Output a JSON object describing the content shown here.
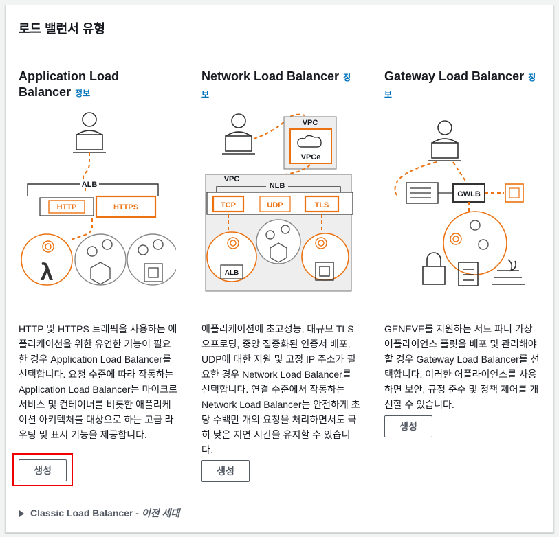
{
  "header": {
    "title": "로드 밸런서 유형"
  },
  "info_label": "정보",
  "cards": [
    {
      "title": "Application Load Balancer",
      "description": "HTTP 및 HTTPS 트래픽을 사용하는 애플리케이션을 위한 유연한 기능이 필요한 경우 Application Load Balancer를 선택합니다. 요청 수준에 따라 작동하는 Application Load Balancer는 마이크로서비스 및 컨테이너를 비롯한 애플리케이션 아키텍처를 대상으로 하는 고급 라우팅 및 표시 기능을 제공합니다.",
      "button": "생성",
      "diagram": {
        "alb": "ALB",
        "http": "HTTP",
        "https": "HTTPS"
      }
    },
    {
      "title": "Network Load Balancer",
      "description": "애플리케이션에 초고성능, 대규모 TLS 오프로딩, 중앙 집중화된 인증서 배포, UDP에 대한 지원 및 고정 IP 주소가 필요한 경우 Network Load Balancer를 선택합니다. 연결 수준에서 작동하는 Network Load Balancer는 안전하게 초당 수백만 개의 요청을 처리하면서도 극히 낮은 지연 시간을 유지할 수 있습니다.",
      "button": "생성",
      "diagram": {
        "vpc_top": "VPC",
        "vpce": "VPCe",
        "vpc": "VPC",
        "nlb": "NLB",
        "tcp": "TCP",
        "udp": "UDP",
        "tls": "TLS",
        "alb": "ALB"
      }
    },
    {
      "title": "Gateway Load Balancer",
      "description": "GENEVE를 지원하는 서드 파티 가상 어플라이언스 플릿을 배포 및 관리해야 할 경우 Gateway Load Balancer를 선택합니다. 이러한 어플라이언스를 사용하면 보안, 규정 준수 및 정책 제어를 개선할 수 있습니다.",
      "button": "생성",
      "diagram": {
        "gwlb": "GWLB"
      }
    }
  ],
  "footer": {
    "label": "Classic Load Balancer",
    "separator": " - ",
    "sublabel": "이전 세대"
  },
  "colors": {
    "accent": "#ec7211",
    "link": "#0073bb",
    "highlight": "#e00000"
  }
}
